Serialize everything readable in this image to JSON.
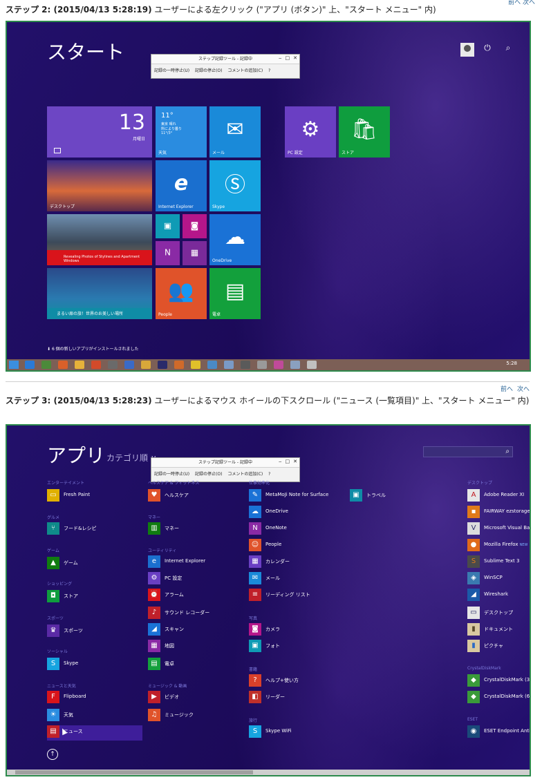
{
  "top_nav": {
    "prev": "前へ",
    "next": "次へ"
  },
  "step2": {
    "label": "ステップ 2: (2015/04/13 5:28:19)",
    "desc": " ユーザーによる左クリック (\"アプリ (ボタン)\" 上、\"スタート メニュー\" 内)"
  },
  "step3": {
    "label": "ステップ 3: (2015/04/13 5:28:23)",
    "desc": " ユーザーによるマウス ホイールの下スクロール (\"ニュース (一覧項目)\" 上、\"スタート メニュー\" 内)",
    "nav_prev": "前へ",
    "nav_next": "次へ"
  },
  "recorder": {
    "title": "ステップ記録ツール - 記録中",
    "pause": "記録の一時停止(U)",
    "stop": "記録の停止(O)",
    "comment": "コメントの追加(C)",
    "help": "?",
    "minimize": "‒",
    "maximize": "□",
    "close": "✕"
  },
  "start_screen": {
    "title": "スタート",
    "tiles": {
      "calendar": {
        "day": "13",
        "weekday": "月曜日"
      },
      "weather": {
        "temp": "11°",
        "detail1": "東京 晴れ",
        "detail2": "所により曇り",
        "detail3": "11°/3°",
        "label": "天気"
      },
      "mail": {
        "label": "メール"
      },
      "pc_settings": {
        "label": "PC 設定"
      },
      "store": {
        "label": "ストア"
      },
      "desktop": {
        "label": "デスクトップ"
      },
      "ie": {
        "label": "Internet Explorer"
      },
      "skype": {
        "label": "Skype"
      },
      "news": {
        "caption": "Revealing Photos of Stylines and Apartment Windows"
      },
      "onedrive": {
        "label": "OneDrive"
      },
      "travel": {
        "caption": "まるい扉の旅！世界のお美しい場所"
      },
      "people": {
        "label": "People"
      },
      "calculator": {
        "label": "電卓"
      }
    },
    "notification": "6 個の新しいアプリがインストールされました",
    "clock": "5:28"
  },
  "apps_screen": {
    "title": "アプリ",
    "sort": "カテゴリ順 ∨",
    "categories": {
      "entertainment": "エンターテイメント",
      "gourmet": "グルメ",
      "games": "ゲーム",
      "shopping": "ショッピング",
      "sports": "スポーツ",
      "social": "ソーシャル",
      "news_weather": "ニュースと天気",
      "health": "ヘルスケア & フィットネス",
      "money": "マネー",
      "utility": "ユーティリティ",
      "music_video": "ミュージック & 動画",
      "productivity": "仕事効率化",
      "photo": "写真",
      "books": "書籍",
      "travel": "旅行",
      "desktop": "デスクトップ",
      "crystal": "CrystalDiskMark",
      "eset": "ESET"
    },
    "apps": {
      "fresh_paint": "Fresh Paint",
      "food": "フード&レシピ",
      "games": "ゲーム",
      "store": "ストア",
      "sports": "スポーツ",
      "skype": "Skype",
      "flipboard": "Flipboard",
      "weather": "天気",
      "news": "ニュース",
      "healthcare": "ヘルスケア",
      "money": "マネー",
      "ie": "Internet Explorer",
      "pc_settings": "PC 設定",
      "alarm": "アラーム",
      "sound_recorder": "サウンド レコーダー",
      "scan": "スキャン",
      "maps": "地図",
      "calculator": "電卓",
      "video": "ビデオ",
      "music": "ミュージック",
      "metamoji": "MetaMoJi Note for Surface",
      "onedrive": "OneDrive",
      "onenote": "OneNote",
      "people": "People",
      "calendar": "カレンダー",
      "mail": "メール",
      "reading_list": "リーディング リスト",
      "camera": "カメラ",
      "photos": "フォト",
      "help_tips": "ヘルプ+使い方",
      "reader": "リーダー",
      "skype_wifi": "Skype WiFi",
      "travel": "トラベル",
      "adobe_reader": "Adobe Reader XI",
      "fairway": "FAIRWAY ezstorage",
      "vs": "Microsoft Visual Bas",
      "firefox": "Mozilla Firefox",
      "firefox_badge": "NEW",
      "sublime": "Sublime Text 3",
      "winscp": "WinSCP",
      "wireshark": "Wireshark",
      "desktop": "デスクトップ",
      "documents": "ドキュメント",
      "pictures": "ピクチャ",
      "crystal32": "CrystalDiskMark (32",
      "crystal64": "CrystalDiskMark (64",
      "eset": "ESET Endpoint Antiv"
    },
    "up_arrow": "↑"
  }
}
